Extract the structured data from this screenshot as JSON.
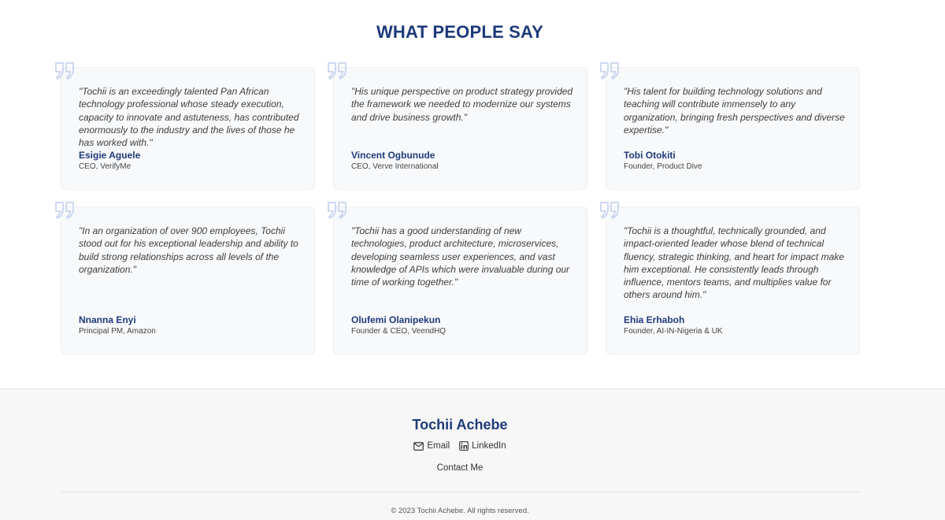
{
  "section": {
    "title": "WHAT PEOPLE SAY"
  },
  "testimonials": [
    {
      "quote": "\"Tochii is an exceedingly talented Pan African technology professional whose steady execution, capacity to innovate and astuteness, has contributed enormously to the industry and the lives of those he has worked with.\"",
      "name": "Esigie Aguele",
      "role": "CEO, VerifyMe"
    },
    {
      "quote": "\"His unique perspective on product strategy provided the framework we needed to modernize our systems and drive business growth.\"",
      "name": "Vincent Ogbunude",
      "role": "CEO, Verve International"
    },
    {
      "quote": "\"His talent for building technology solutions and teaching will contribute immensely to any organization, bringing fresh perspectives and diverse expertise.\"",
      "name": "Tobi Otokiti",
      "role": "Founder, Product Dive"
    },
    {
      "quote": "\"In an organization of over 900 employees, Tochii stood out for his exceptional leadership and ability to build strong relationships across all levels of the organization.\"",
      "name": "Nnanna Enyi",
      "role": "Principal PM, Amazon"
    },
    {
      "quote": "\"Tochii has a good understanding of new technologies, product architecture, microservices, developing seamless user experiences, and vast knowledge of APIs which were invaluable during our time of working together.\"",
      "name": "Olufemi Olanipekun",
      "role": "Founder & CEO, VeendHQ"
    },
    {
      "quote": "\"Tochii is a thoughtful, technically grounded, and impact-oriented leader whose blend of technical fluency, strategic thinking, and heart for impact make him exceptional. He consistently leads through influence, mentors teams, and multiplies value for others around him.\"",
      "name": "Ehia Erhaboh",
      "role": "Founder, AI-IN-Nigeria & UK"
    }
  ],
  "footer": {
    "name": "Tochii Achebe",
    "email_label": "Email",
    "linkedin_label": "LinkedIn",
    "contact_label": "Contact Me",
    "copyright": "© 2023 Tochii Achebe. All rights reserved."
  },
  "colors": {
    "accent": "#1e3a7b",
    "quote_icon": "#c7d3ee",
    "card_bg": "#f8f9fb",
    "footer_bg": "#f7f7f7"
  },
  "icons": {
    "quote": "quote-icon",
    "email": "envelope-icon",
    "linkedin": "linkedin-icon"
  }
}
